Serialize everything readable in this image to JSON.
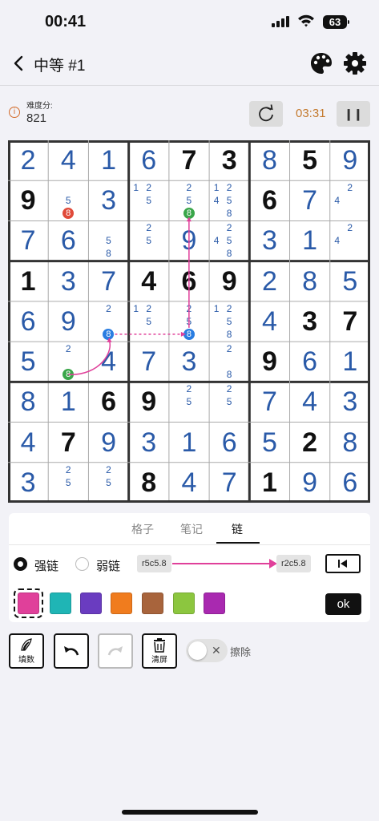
{
  "status_bar": {
    "time": "00:41",
    "battery": "63"
  },
  "header": {
    "title": "中等 #1"
  },
  "info": {
    "difficulty_label": "难度分:",
    "difficulty_value": "821",
    "timer": "03:31"
  },
  "colors": {
    "given": "#111111",
    "filled": "#2a5aa8",
    "chain": "#e0409a",
    "candidate_red": "#e04a3a",
    "candidate_green": "#3aa64a",
    "candidate_blue": "#2a7de1"
  },
  "grid": {
    "rows": [
      [
        {
          "v": "2",
          "t": "f"
        },
        {
          "v": "4",
          "t": "f"
        },
        {
          "v": "1",
          "t": "f"
        },
        {
          "v": "6",
          "t": "f"
        },
        {
          "v": "7",
          "t": "g"
        },
        {
          "v": "3",
          "t": "g"
        },
        {
          "v": "8",
          "t": "f"
        },
        {
          "v": "5",
          "t": "g"
        },
        {
          "v": "9",
          "t": "f"
        }
      ],
      [
        {
          "v": "9",
          "t": "g"
        },
        {
          "n": [
            "5",
            "8"
          ],
          "hl": {
            "8": "red"
          }
        },
        {
          "v": "3",
          "t": "f"
        },
        {
          "n": [
            "1",
            "2",
            "5"
          ]
        },
        {
          "n": [
            "2",
            "5",
            "8"
          ],
          "hl": {
            "8": "green"
          }
        },
        {
          "n": [
            "1",
            "2",
            "4",
            "5",
            "8"
          ]
        },
        {
          "v": "6",
          "t": "g"
        },
        {
          "v": "7",
          "t": "f"
        },
        {
          "n": [
            "2",
            "4"
          ]
        }
      ],
      [
        {
          "v": "7",
          "t": "f"
        },
        {
          "v": "6",
          "t": "f"
        },
        {
          "n": [
            "5",
            "8"
          ]
        },
        {
          "n": [
            "2",
            "5"
          ]
        },
        {
          "v": "9",
          "t": "f"
        },
        {
          "n": [
            "2",
            "4",
            "5",
            "8"
          ]
        },
        {
          "v": "3",
          "t": "f"
        },
        {
          "v": "1",
          "t": "f"
        },
        {
          "n": [
            "2",
            "4"
          ]
        }
      ],
      [
        {
          "v": "1",
          "t": "g"
        },
        {
          "v": "3",
          "t": "f"
        },
        {
          "v": "7",
          "t": "f"
        },
        {
          "v": "4",
          "t": "g"
        },
        {
          "v": "6",
          "t": "g"
        },
        {
          "v": "9",
          "t": "g"
        },
        {
          "v": "2",
          "t": "f"
        },
        {
          "v": "8",
          "t": "f"
        },
        {
          "v": "5",
          "t": "f"
        }
      ],
      [
        {
          "v": "6",
          "t": "f"
        },
        {
          "v": "9",
          "t": "f"
        },
        {
          "n": [
            "2",
            "8"
          ],
          "hl": {
            "8": "blue"
          }
        },
        {
          "n": [
            "1",
            "2",
            "5"
          ]
        },
        {
          "n": [
            "2",
            "5",
            "8"
          ],
          "hl": {
            "8": "blue"
          }
        },
        {
          "n": [
            "1",
            "2",
            "5",
            "8"
          ]
        },
        {
          "v": "4",
          "t": "f"
        },
        {
          "v": "3",
          "t": "g"
        },
        {
          "v": "7",
          "t": "g"
        }
      ],
      [
        {
          "v": "5",
          "t": "f"
        },
        {
          "n": [
            "2",
            "8"
          ],
          "hl": {
            "8": "green"
          }
        },
        {
          "v": "4",
          "t": "f"
        },
        {
          "v": "7",
          "t": "f"
        },
        {
          "v": "3",
          "t": "f"
        },
        {
          "n": [
            "2",
            "8"
          ]
        },
        {
          "v": "9",
          "t": "g"
        },
        {
          "v": "6",
          "t": "f"
        },
        {
          "v": "1",
          "t": "f"
        }
      ],
      [
        {
          "v": "8",
          "t": "f"
        },
        {
          "v": "1",
          "t": "f"
        },
        {
          "v": "6",
          "t": "g"
        },
        {
          "v": "9",
          "t": "g"
        },
        {
          "n": [
            "2",
            "5"
          ]
        },
        {
          "n": [
            "2",
            "5"
          ]
        },
        {
          "v": "7",
          "t": "f"
        },
        {
          "v": "4",
          "t": "f"
        },
        {
          "v": "3",
          "t": "f"
        }
      ],
      [
        {
          "v": "4",
          "t": "f"
        },
        {
          "v": "7",
          "t": "g"
        },
        {
          "v": "9",
          "t": "f"
        },
        {
          "v": "3",
          "t": "f"
        },
        {
          "v": "1",
          "t": "f"
        },
        {
          "v": "6",
          "t": "f"
        },
        {
          "v": "5",
          "t": "f"
        },
        {
          "v": "2",
          "t": "g"
        },
        {
          "v": "8",
          "t": "f"
        }
      ],
      [
        {
          "v": "3",
          "t": "f"
        },
        {
          "n": [
            "2",
            "5"
          ]
        },
        {
          "n": [
            "2",
            "5"
          ]
        },
        {
          "v": "8",
          "t": "g"
        },
        {
          "v": "4",
          "t": "f"
        },
        {
          "v": "7",
          "t": "f"
        },
        {
          "v": "1",
          "t": "g"
        },
        {
          "v": "9",
          "t": "f"
        },
        {
          "v": "6",
          "t": "f"
        }
      ]
    ]
  },
  "tabs": [
    {
      "label": "格子",
      "active": false
    },
    {
      "label": "笔记",
      "active": false
    },
    {
      "label": "链",
      "active": true
    }
  ],
  "chain_panel": {
    "strong_label": "强链",
    "weak_label": "弱链",
    "from": "r5c5.8",
    "to": "r2c5.8",
    "ok_label": "ok",
    "swatches": [
      "#e0409a",
      "#1fb5b5",
      "#6a3cc0",
      "#f07c1e",
      "#a8643c",
      "#8cc63f",
      "#a929b0"
    ]
  },
  "toolbar": {
    "fill_label": "填数",
    "clear_label": "清屏",
    "erase_label": "擦除"
  }
}
